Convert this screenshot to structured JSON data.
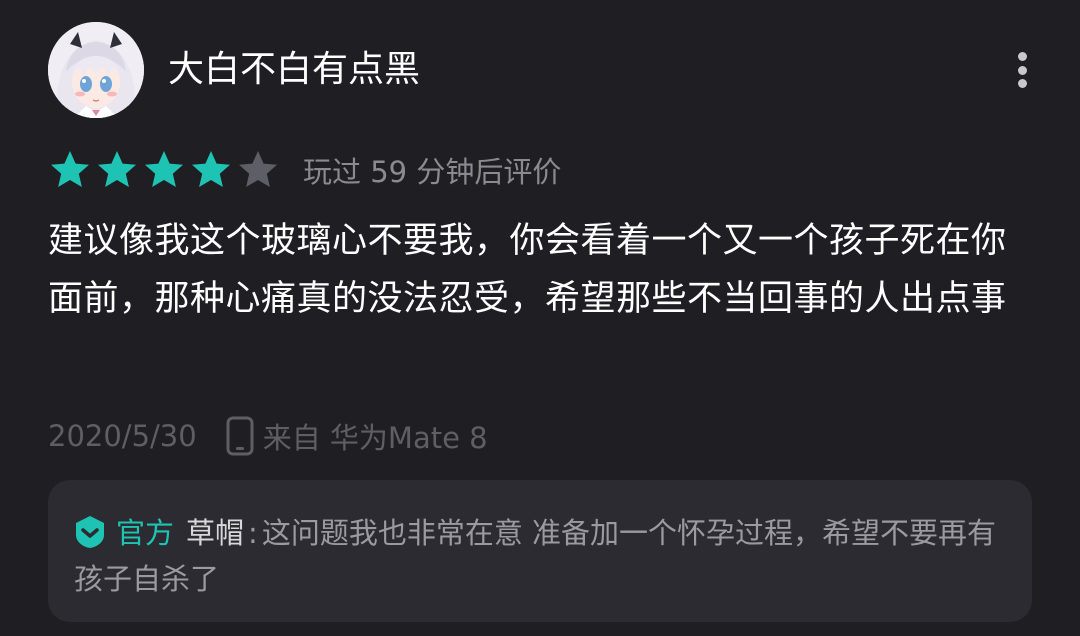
{
  "user": {
    "name": "大白不白有点黑"
  },
  "rating": {
    "value": 4,
    "max": 5,
    "played_text": "玩过 59 分钟后评价",
    "colors": {
      "filled": "#1fc3b4",
      "empty": "#5e5e66"
    }
  },
  "review": {
    "text": "建议像我这个玻璃心不要我，你会看着一个又一个孩子死在你面前，那种心痛真的没法忍受，希望那些不当回事的人出点事"
  },
  "meta": {
    "date": "2020/5/30",
    "device": "来自 华为Mate 8"
  },
  "reply": {
    "badge_label": "官方",
    "author": "草帽",
    "separator": ":",
    "text": "这问题我也非常在意 准备加一个怀孕过程，希望不要再有孩子自杀了"
  },
  "icons": {
    "more": "more-vertical-icon",
    "device": "phone-icon",
    "official": "official-shield-icon",
    "star": "star-icon"
  }
}
